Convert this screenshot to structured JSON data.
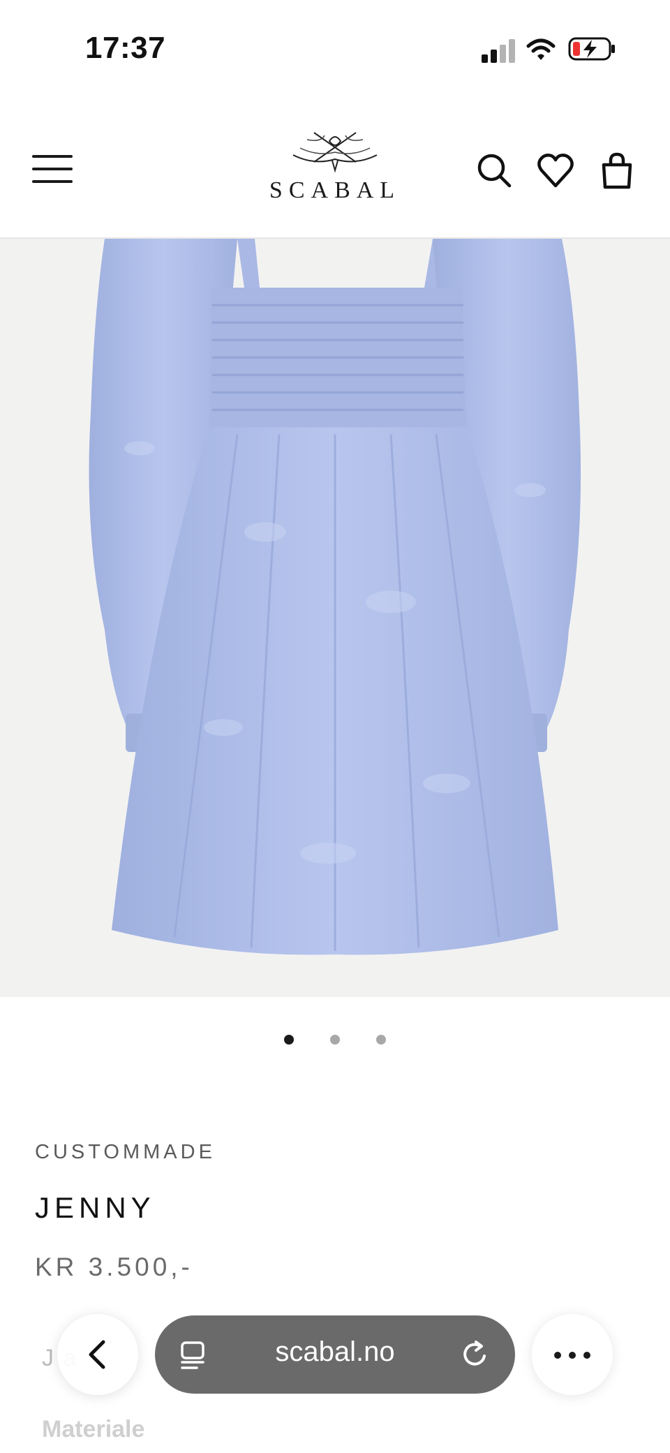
{
  "status_bar": {
    "time": "17:37",
    "icons": [
      "cellular-signal-icon",
      "wifi-icon",
      "battery-charging-icon"
    ]
  },
  "header": {
    "logo_text": "SCABAL",
    "icons": [
      "menu-icon",
      "search-icon",
      "heart-icon",
      "bag-icon"
    ]
  },
  "product": {
    "image_color": "#aebde8",
    "carousel": {
      "count": 3,
      "active_index": 0
    },
    "brand": "CUSTOMMADE",
    "name": "JENNY",
    "price": "KR 3.500,-",
    "description_partial": "J         a",
    "materials_label": "Materiale"
  },
  "browser": {
    "url": "scabal.no",
    "icons": [
      "back-chevron-icon",
      "tabs-icon",
      "reload-icon",
      "more-icon"
    ],
    "pill_color": "#6a6a6a"
  }
}
